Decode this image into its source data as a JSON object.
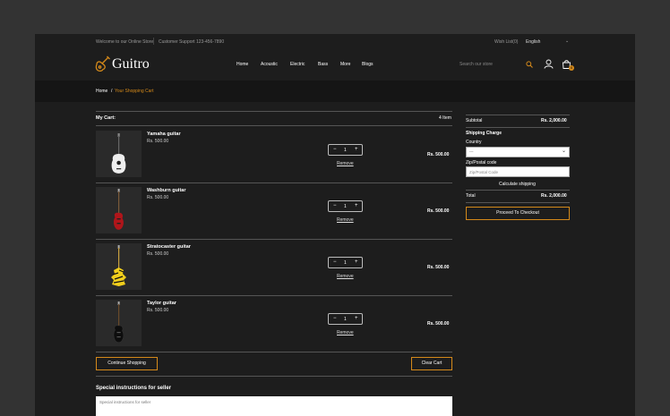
{
  "colors": {
    "accent": "#d4891a",
    "page_bg": "#1d1d1d",
    "outer_bg": "#333333"
  },
  "topbar": {
    "welcome": "Welcome to our Online Store",
    "support": "Customer Support 123-456-7890",
    "wishlist": "Wish List(0)",
    "language": "English"
  },
  "header": {
    "logo_text": "Guitro",
    "nav": [
      "Home",
      "Acoustic",
      "Electric",
      "Bass",
      "More",
      "Blogs"
    ],
    "search_placeholder": "Search our store",
    "cart_count": "0"
  },
  "breadcrumb": {
    "home": "Home",
    "separator": "/",
    "current": "Your Shopping Cart"
  },
  "cart": {
    "title": "My Cart:",
    "count": "4 Item",
    "items": [
      {
        "name": "Yamaha guitar",
        "price": "Rs. 500.00",
        "qty": "1",
        "total": "Rs. 500.00",
        "remove": "Remove",
        "image": "white-acoustic-guitar"
      },
      {
        "name": "Washburn guitar",
        "price": "Rs. 500.00",
        "qty": "1",
        "total": "Rs. 500.00",
        "remove": "Remove",
        "image": "red-bass-guitar"
      },
      {
        "name": "Stratocaster guitar",
        "price": "Rs. 500.00",
        "qty": "1",
        "total": "Rs. 500.00",
        "remove": "Remove",
        "image": "yellow-tiger-guitar"
      },
      {
        "name": "Taylor guitar",
        "price": "Rs. 500.00",
        "qty": "1",
        "total": "Rs. 500.00",
        "remove": "Remove",
        "image": "black-bass-guitar"
      }
    ],
    "continue_label": "Continue Shopping",
    "clear_label": "Clear Cart",
    "special_title": "Special instructions for seller",
    "special_placeholder": "Special instructions for seller"
  },
  "summary": {
    "subtotal_label": "Subtotal",
    "subtotal_value": "Rs. 2,000.00",
    "shipping_title": "Shipping Charge",
    "country_label": "Country",
    "country_value": "---",
    "zip_label": "Zip/Postal code",
    "zip_placeholder": "Zip/Postal Code",
    "calc_label": "Calculate shipping",
    "total_label": "Total",
    "total_value": "Rs. 2,000.00",
    "checkout_label": "Proceed To Checkout"
  }
}
